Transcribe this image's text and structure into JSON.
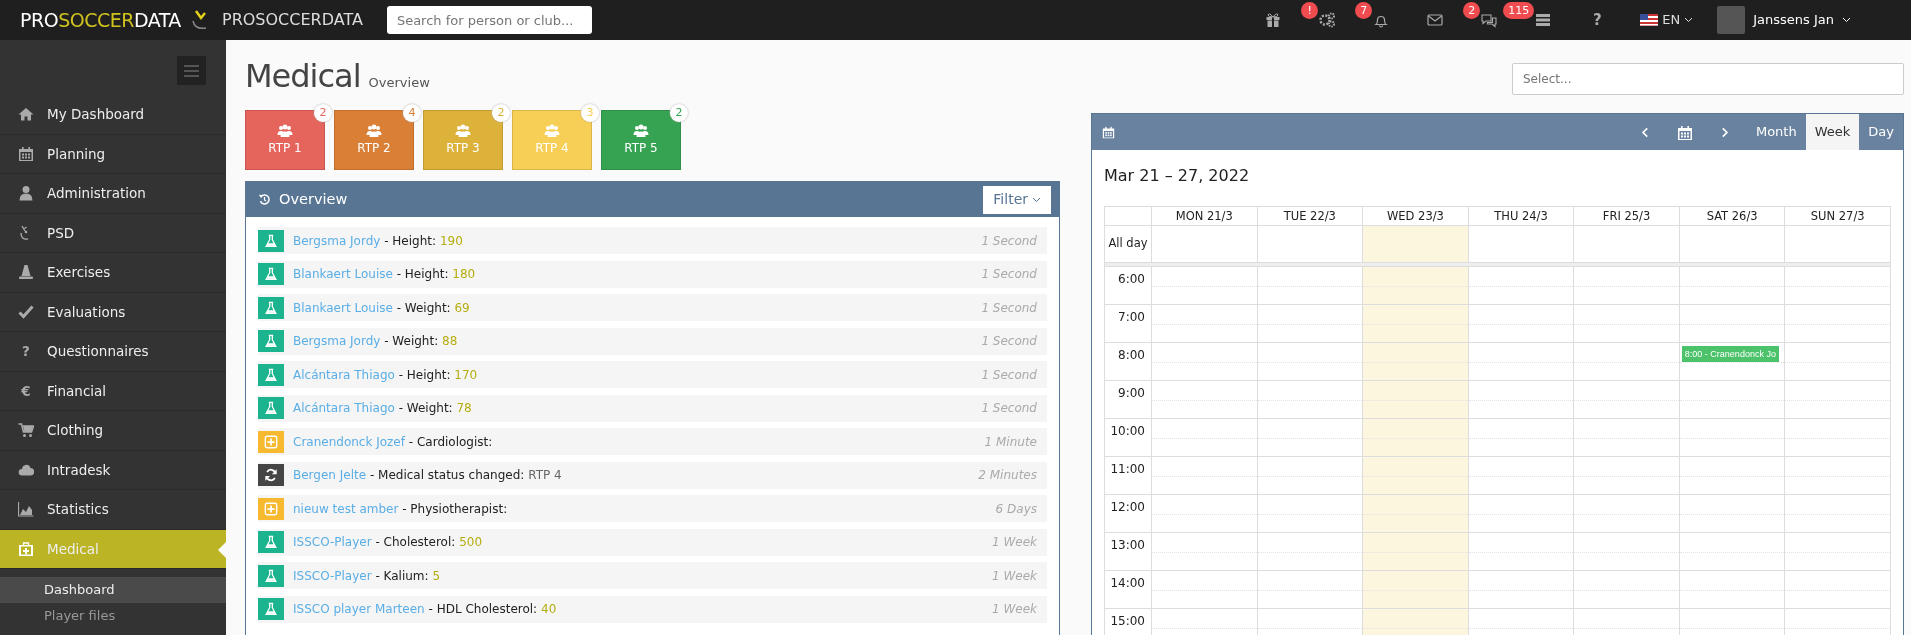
{
  "topbar": {
    "logo": [
      {
        "text": "PRO",
        "highlight": false
      },
      {
        "text": "SOCCER",
        "highlight": true
      },
      {
        "text": "DATA",
        "highlight": false
      }
    ],
    "brand": "PROSOCCERDATA",
    "search": {
      "placeholder": "Search for person or club..."
    },
    "toolbar": [
      {
        "kind": "gift"
      },
      {
        "kind": "gears",
        "badge": "!"
      },
      {
        "kind": "bell",
        "badge": "7"
      },
      {
        "kind": "mail"
      },
      {
        "kind": "chat",
        "badge": "2"
      },
      {
        "kind": "list",
        "badge": "115"
      },
      {
        "kind": "help",
        "glyph": "?"
      }
    ],
    "language": {
      "label": "EN"
    },
    "user": {
      "name": "Janssens Jan"
    }
  },
  "sidebar": {
    "items": [
      {
        "label": "My Dashboard",
        "selected": false
      },
      {
        "label": "Planning",
        "selected": false
      },
      {
        "label": "Administration",
        "selected": false
      },
      {
        "label": "PSD",
        "selected": false
      },
      {
        "label": "Exercises",
        "selected": false
      },
      {
        "label": "Evaluations",
        "selected": false
      },
      {
        "label": "Questionnaires",
        "glyph": "?",
        "selected": false
      },
      {
        "label": "Financial",
        "glyph": "€",
        "selected": false
      },
      {
        "label": "Clothing",
        "selected": false
      },
      {
        "label": "Intradesk",
        "selected": false
      },
      {
        "label": "Statistics",
        "selected": false
      },
      {
        "label": "Medical",
        "selected": true,
        "children": [
          {
            "label": "Dashboard",
            "selected": true
          },
          {
            "label": "Player files",
            "selected": false
          }
        ]
      }
    ]
  },
  "page": {
    "title": "Medical",
    "subtitle": "Overview",
    "select": {
      "placeholder": "Select..."
    }
  },
  "rtp_tiles": [
    {
      "label": "RTP 1",
      "count": "2",
      "color": "#e5645b"
    },
    {
      "label": "RTP 2",
      "count": "4",
      "color": "#d97f36"
    },
    {
      "label": "RTP 3",
      "count": "2",
      "color": "#ddb23b"
    },
    {
      "label": "RTP 4",
      "count": "3",
      "color": "#f7cf56"
    },
    {
      "label": "RTP 5",
      "count": "2",
      "color": "#36a352"
    }
  ],
  "overview": {
    "title": "Overview",
    "filter": "Filter",
    "rows": [
      {
        "kind": "measurement",
        "person": "Bergsma Jordy",
        "detail": "- Height:",
        "value": "190",
        "time": "1 Second"
      },
      {
        "kind": "measurement",
        "person": "Blankaert Louise",
        "detail": "- Height:",
        "value": "180",
        "time": "1 Second"
      },
      {
        "kind": "measurement",
        "person": "Blankaert Louise",
        "detail": "- Weight:",
        "value": "69",
        "time": "1 Second"
      },
      {
        "kind": "measurement",
        "person": "Bergsma Jordy",
        "detail": "- Weight:",
        "value": "88",
        "time": "1 Second"
      },
      {
        "kind": "measurement",
        "person": "Alcántara Thiago",
        "detail": "- Height:",
        "value": "170",
        "time": "1 Second"
      },
      {
        "kind": "measurement",
        "person": "Alcántara Thiago",
        "detail": "- Weight:",
        "value": "78",
        "time": "1 Second"
      },
      {
        "kind": "consult",
        "person": "Cranendonck Jozef",
        "detail": "- Cardiologist:",
        "time": "1 Minute"
      },
      {
        "kind": "status",
        "person": "Bergen Jelte",
        "detail": "- Medical status changed:",
        "value": "RTP 4",
        "time": "2 Minutes"
      },
      {
        "kind": "consult",
        "person": "nieuw test amber",
        "detail": "- Physiotherapist:",
        "time": "6 Days"
      },
      {
        "kind": "measurement",
        "person": "ISSCO-Player",
        "detail": "- Cholesterol:",
        "value": "500",
        "time": "1 Week"
      },
      {
        "kind": "measurement",
        "person": "ISSCO-Player",
        "detail": "- Kalium:",
        "value": "5",
        "time": "1 Week"
      },
      {
        "kind": "measurement",
        "person": "ISSCO player Marteen",
        "detail": "- HDL Cholesterol:",
        "value": "40",
        "time": "1 Week"
      }
    ]
  },
  "calendar": {
    "range": "Mar 21 – 27, 2022",
    "views": [
      {
        "label": "Month",
        "selected": false
      },
      {
        "label": "Week",
        "selected": true
      },
      {
        "label": "Day",
        "selected": false
      }
    ],
    "all_day": "All day",
    "days": [
      {
        "label": "MON 21/3",
        "today": false
      },
      {
        "label": "TUE 22/3",
        "today": false
      },
      {
        "label": "WED 23/3",
        "today": true
      },
      {
        "label": "THU 24/3",
        "today": false
      },
      {
        "label": "FRI 25/3",
        "today": false
      },
      {
        "label": "SAT 26/3",
        "today": false,
        "events": [
          {
            "text": "8:00 - Cranendonck Jo",
            "color": "#4cc36a"
          }
        ]
      },
      {
        "label": "SUN 27/3",
        "today": false
      }
    ],
    "hours": [
      "6:00",
      "7:00",
      "8:00",
      "9:00",
      "10:00",
      "11:00",
      "12:00",
      "13:00",
      "14:00",
      "15:00"
    ]
  }
}
